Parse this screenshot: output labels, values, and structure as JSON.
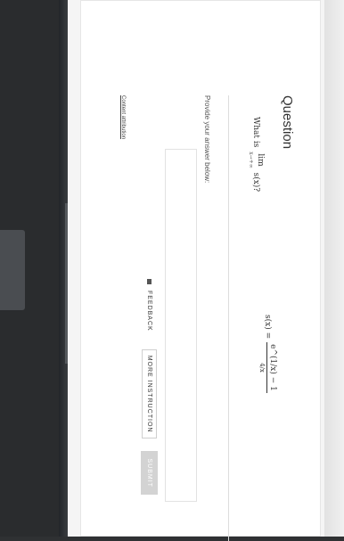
{
  "question": {
    "title": "Question",
    "prompt_prefix": "What is",
    "lim_word": "lim",
    "lim_subscript": "x→+∞",
    "lim_function": "s(x)?",
    "formula_lhs": "s(x) =",
    "formula_numerator": "e^(1/x) − 1",
    "formula_denominator": "4/x"
  },
  "answer": {
    "label": "Provide your answer below:",
    "value": ""
  },
  "buttons": {
    "feedback": "FEEDBACK",
    "more_instruction": "MORE INSTRUCTION",
    "submit": "SUBMIT"
  },
  "footer": {
    "content_attribution": "Content attribution"
  }
}
